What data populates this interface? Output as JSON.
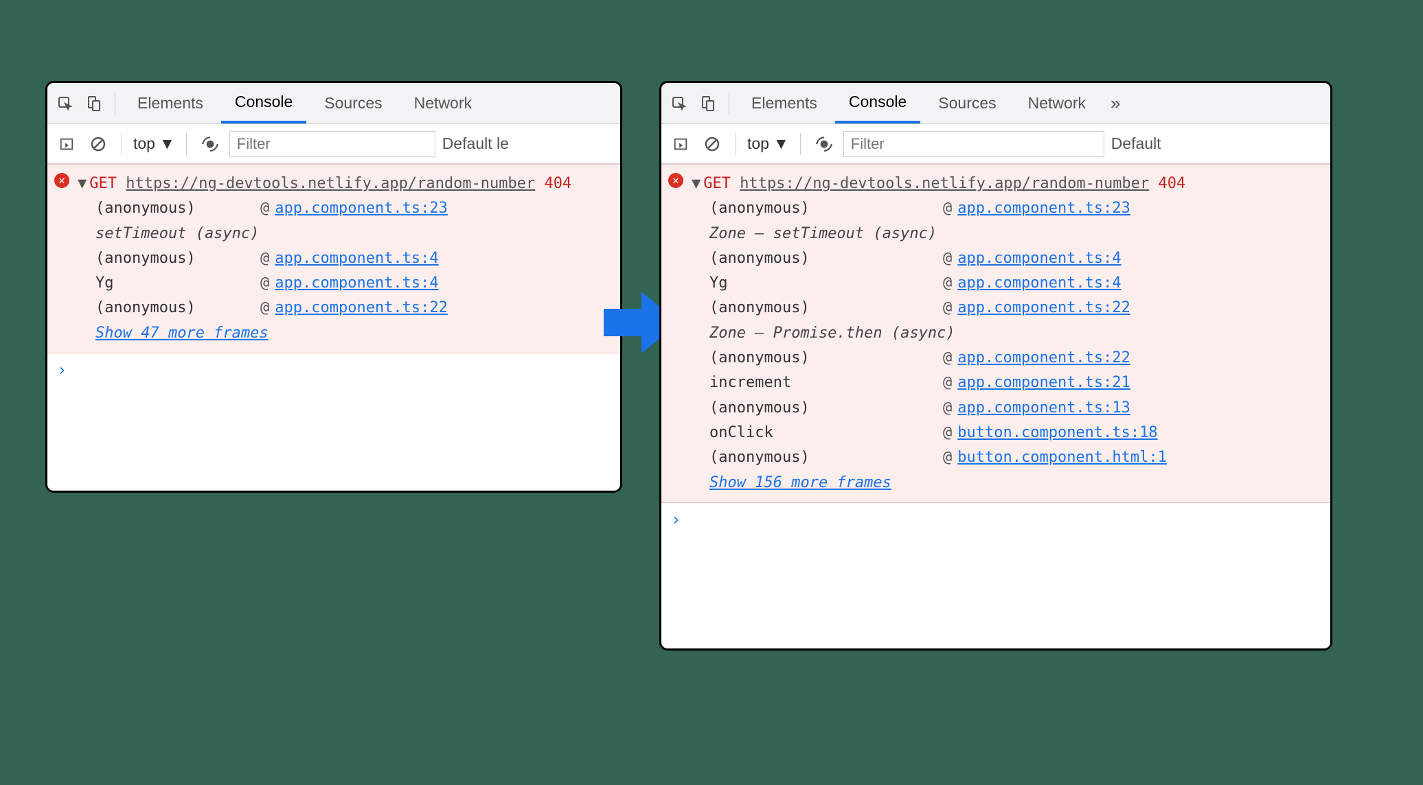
{
  "tabs": {
    "elements": "Elements",
    "console": "Console",
    "sources": "Sources",
    "network": "Network",
    "more": "»"
  },
  "toolbar": {
    "context": "top",
    "filter_placeholder": "Filter",
    "levels_left": "Default le",
    "levels_right": "Default"
  },
  "error": {
    "method": "GET",
    "url_left": "https://ng-devtools.netlify.app/random-number",
    "url_right": "https://ng-devtools.netlify.app/random-number",
    "status": "404"
  },
  "left": {
    "rows": [
      {
        "kind": "frame",
        "fn": "(anonymous)",
        "src": "app.component.ts:23"
      },
      {
        "kind": "async",
        "label": "setTimeout (async)"
      },
      {
        "kind": "frame",
        "fn": "(anonymous)",
        "src": "app.component.ts:4"
      },
      {
        "kind": "frame",
        "fn": "Yg",
        "src": "app.component.ts:4"
      },
      {
        "kind": "frame",
        "fn": "(anonymous)",
        "src": "app.component.ts:22"
      }
    ],
    "show_more": "Show 47 more frames"
  },
  "right": {
    "rows": [
      {
        "kind": "frame",
        "fn": "(anonymous)",
        "src": "app.component.ts:23"
      },
      {
        "kind": "async",
        "label": "Zone — setTimeout (async)"
      },
      {
        "kind": "frame",
        "fn": "(anonymous)",
        "src": "app.component.ts:4"
      },
      {
        "kind": "frame",
        "fn": "Yg",
        "src": "app.component.ts:4"
      },
      {
        "kind": "frame",
        "fn": "(anonymous)",
        "src": "app.component.ts:22"
      },
      {
        "kind": "async",
        "label": "Zone — Promise.then (async)"
      },
      {
        "kind": "frame",
        "fn": "(anonymous)",
        "src": "app.component.ts:22"
      },
      {
        "kind": "frame",
        "fn": "increment",
        "src": "app.component.ts:21"
      },
      {
        "kind": "frame",
        "fn": "(anonymous)",
        "src": "app.component.ts:13"
      },
      {
        "kind": "frame",
        "fn": "onClick",
        "src": "button.component.ts:18"
      },
      {
        "kind": "frame",
        "fn": "(anonymous)",
        "src": "button.component.html:1"
      }
    ],
    "show_more": "Show 156 more frames"
  },
  "prompt": "›"
}
